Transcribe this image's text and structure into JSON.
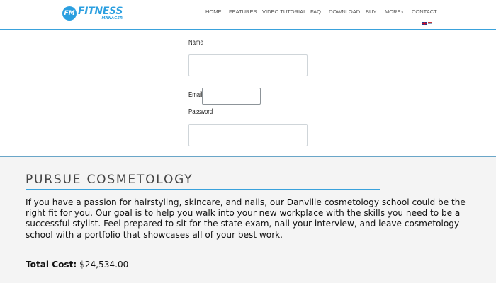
{
  "brand": {
    "logo_badge": "FM",
    "logo_main": "FITNESS",
    "logo_sub": "MANAGER",
    "accent_color": "#2b9fe0"
  },
  "nav": {
    "items": [
      {
        "label": "HOME"
      },
      {
        "label": "FEATURES"
      },
      {
        "label": "VIDEO TUTORIAL"
      },
      {
        "label": "FAQ"
      },
      {
        "label": "DOWNLOAD"
      },
      {
        "label": "BUY"
      },
      {
        "label": "MORE"
      },
      {
        "label": "CONTACT"
      }
    ],
    "more_caret": "▾",
    "languages": [
      "uk-flag-icon",
      "serbia-flag-icon"
    ]
  },
  "form": {
    "name_label": "Name",
    "email_label": "Email",
    "password_label": "Password",
    "name_value": "",
    "email_value": "",
    "password_value": ""
  },
  "section": {
    "title": "PURSUE COSMETOLOGY",
    "body": "If you have a passion for hairstyling, skincare, and nails, our Danville cosmetology school could be the right fit for you. Our goal is to help you walk into your new workplace with the skills you need to be a successful stylist. Feel prepared to sit for the state exam, nail your interview, and leave cosmetology school with a portfolio that showcases all of your best work.",
    "cost_label": "Total Cost:",
    "cost_value": "$24,534.00"
  }
}
